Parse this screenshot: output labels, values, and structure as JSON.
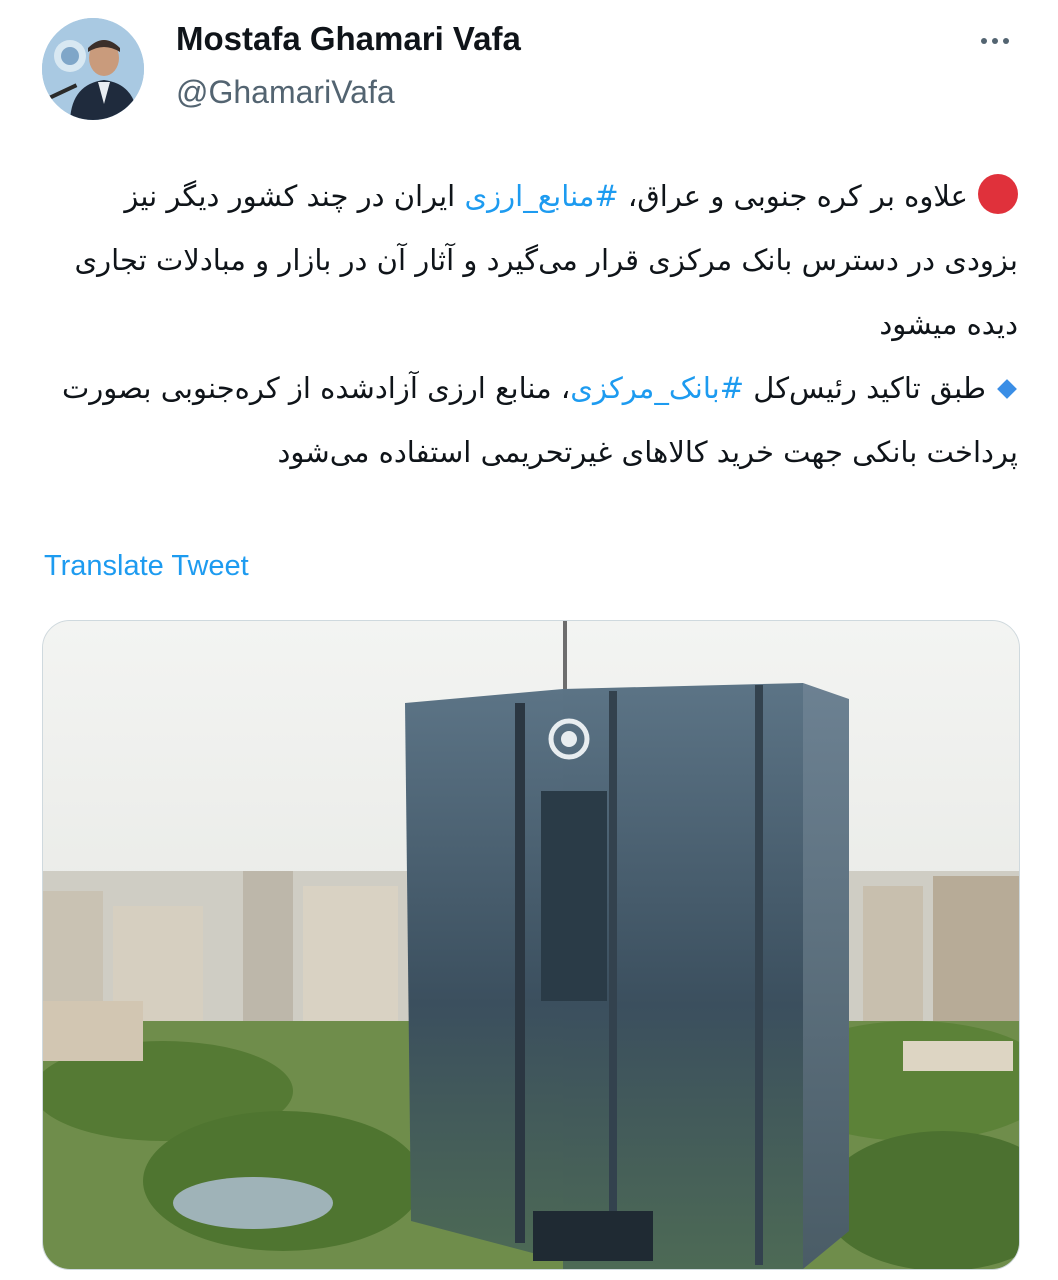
{
  "tweet": {
    "author": {
      "display_name": "Mostafa Ghamari Vafa",
      "handle": "@GhamariVafa",
      "avatar_icon": "profile-photo"
    },
    "more_icon": "more-horizontal-icon",
    "paragraph_1": {
      "bullet_icon": "red-circle-icon",
      "text_before": "علاوه بر کره جنوبی و عراق، ",
      "hashtag": "#منابع_ارزی",
      "text_after": " ایران در چند کشور دیگر نیز بزودی در دسترس بانک مرکزی قرار می‌گیرد و آثار آن در بازار و مبادلات تجاری دیده میشود"
    },
    "paragraph_2": {
      "bullet_icon": "blue-diamond-icon",
      "text_before": "طبق تاکید رئیس‌کل ",
      "hashtag": "#بانک_مرکزی",
      "text_after": "، منابع ارزی آزادشده از کره‌جنوبی بصورت پرداخت بانکی جهت خرید کالاهای غیرتحریمی استفاده می‌شود"
    },
    "translate_label": "Translate Tweet",
    "media": {
      "image_icon": "central-bank-building-photo",
      "colors": {
        "sky": "#e9ebe8",
        "glass": "#3e5566",
        "greenery": "#5f8c3a"
      }
    }
  }
}
